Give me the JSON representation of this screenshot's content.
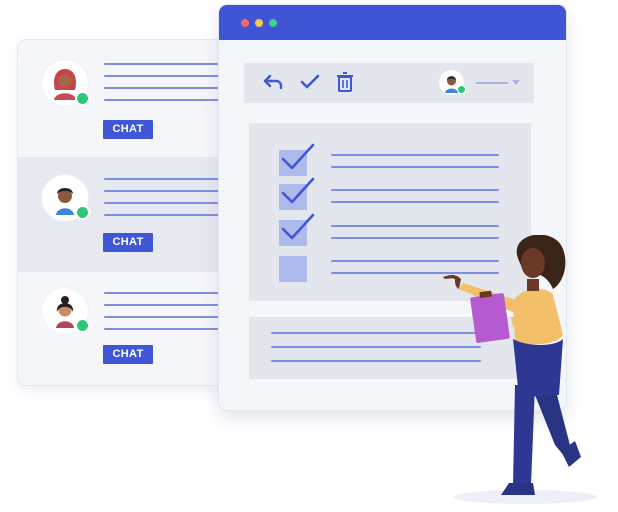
{
  "chat_list": {
    "contacts": [
      {
        "button_label": "CHAT",
        "avatar": "woman-red-hair-avatar",
        "status": "online"
      },
      {
        "button_label": "CHAT",
        "avatar": "man-blue-shirt-avatar",
        "status": "online"
      },
      {
        "button_label": "CHAT",
        "avatar": "woman-dark-hair-avatar",
        "status": "online"
      }
    ]
  },
  "window": {
    "window_dots": [
      "#f06a6a",
      "#f5c84c",
      "#3fcf8e"
    ],
    "toolbar": {
      "icons": [
        "undo-icon",
        "check-icon",
        "trash-icon"
      ],
      "user_status": "online"
    },
    "tasks": {
      "checked": [
        true,
        true,
        true,
        false
      ]
    }
  },
  "colors": {
    "accent": "#4054d6",
    "button": "#3f57d6",
    "online": "#2ec77a",
    "text_line": "#7f8de0",
    "checkbox": "#aeb9ec"
  },
  "illustration": {
    "person": "woman-holding-clipboard-pointing"
  }
}
